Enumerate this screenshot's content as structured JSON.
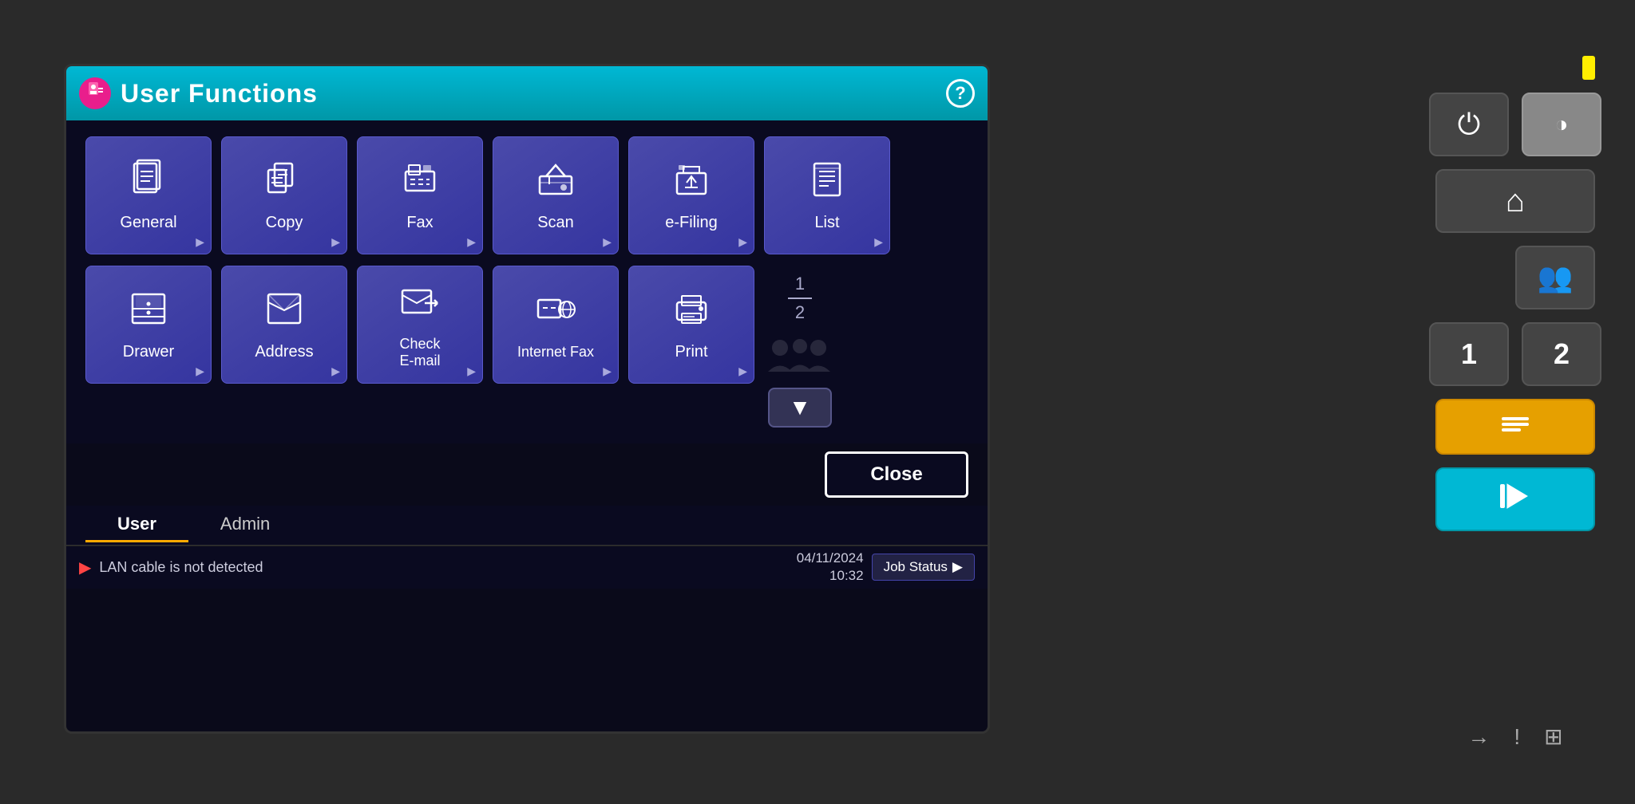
{
  "title_bar": {
    "title": "User Functions",
    "help_label": "?"
  },
  "grid_row1": [
    {
      "id": "general",
      "label": "General",
      "icon": "📄"
    },
    {
      "id": "copy",
      "label": "Copy",
      "icon": "📋"
    },
    {
      "id": "fax",
      "label": "Fax",
      "icon": "📠"
    },
    {
      "id": "scan",
      "label": "Scan",
      "icon": "🖨"
    },
    {
      "id": "efiling",
      "label": "e-Filing",
      "icon": "📦"
    },
    {
      "id": "list",
      "label": "List",
      "icon": "📃"
    }
  ],
  "grid_row2": [
    {
      "id": "drawer",
      "label": "Drawer",
      "icon": "🗄"
    },
    {
      "id": "address",
      "label": "Address",
      "icon": "📒"
    },
    {
      "id": "check-email",
      "label": "Check\nE-mail",
      "icon": "✉"
    },
    {
      "id": "internet-fax",
      "label": "Internet Fax",
      "icon": "🌐"
    },
    {
      "id": "print",
      "label": "Print",
      "icon": "🖨"
    }
  ],
  "page_indicator": {
    "current": "1",
    "total": "2"
  },
  "close_btn": "Close",
  "tabs": [
    {
      "id": "user",
      "label": "User",
      "active": true
    },
    {
      "id": "admin",
      "label": "Admin",
      "active": false
    }
  ],
  "status": {
    "message": "LAN cable is not detected",
    "datetime": "04/11/2024\n10:32",
    "job_status": "Job Status"
  },
  "control_panel": {
    "power_label": "⏻",
    "home_label": "⌂",
    "users_label": "👥",
    "num1": "1",
    "num2": "2",
    "yellow_btn": "⟵",
    "cyan_btn": "◈",
    "bottom_icons": [
      "→",
      "!",
      "⊞"
    ]
  }
}
